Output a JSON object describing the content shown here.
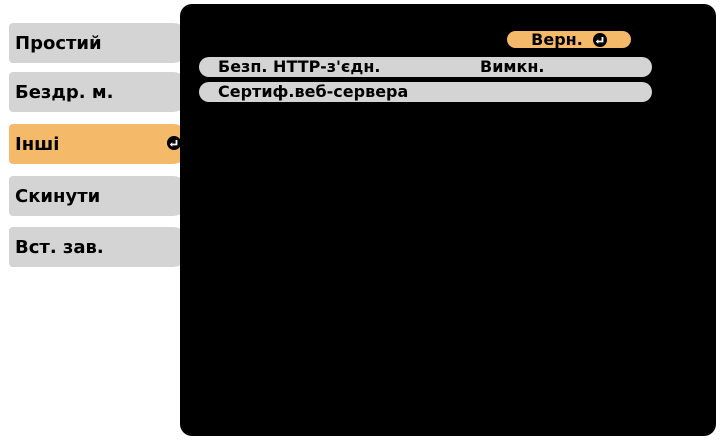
{
  "sidebar": {
    "items": [
      {
        "label": "Простий"
      },
      {
        "label": "Бездр. м."
      },
      {
        "label": "Інші"
      },
      {
        "label": "Скинути"
      },
      {
        "label": "Вст. зав."
      }
    ],
    "active_index": 2
  },
  "main": {
    "back_label": "Верн.",
    "rows": [
      {
        "label": "Безп. HTTP-з'єдн.",
        "value": "Вимкн."
      },
      {
        "label": "Сертиф.веб-сервера",
        "value": ""
      }
    ]
  },
  "colors": {
    "active_tab": "#f5b96a",
    "inactive_tab": "#d4d4d4",
    "panel": "#000000"
  },
  "icons": {
    "enter": "enter-icon"
  }
}
